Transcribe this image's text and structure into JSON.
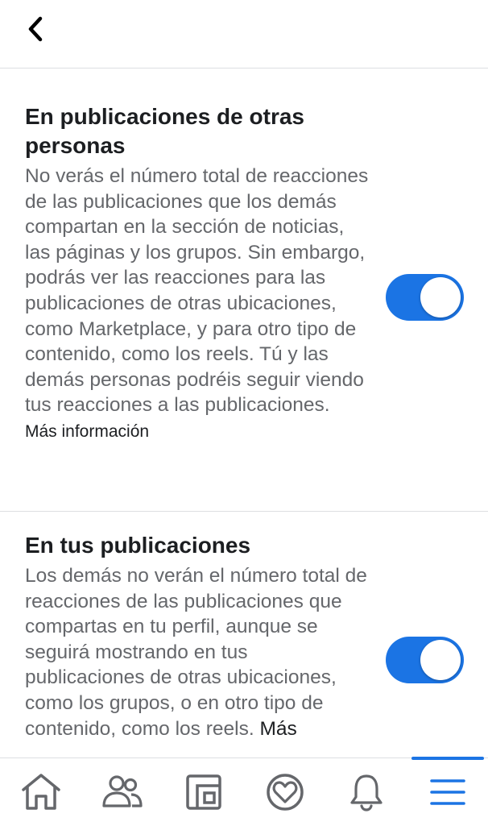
{
  "sections": [
    {
      "title": "En publicaciones de otras personas",
      "description": "No verás el número total de reacciones de las publicaciones que los demás compartan en la sección de noticias, las páginas y los grupos. Sin embargo, podrás ver las reacciones para las publicaciones de otras ubicaciones, como Marketplace, y para otro tipo de contenido, como los reels. Tú y las demás personas podréis seguir viendo tus reacciones a las publicaciones.",
      "more_link": "Más información",
      "toggle_on": true
    },
    {
      "title": "En tus publicaciones",
      "description": "Los demás no verán el número total de reacciones de las publicaciones que compartas en tu perfil, aunque se seguirá mostrando en tus publicaciones de otras ubicaciones, como los grupos, o en otro tipo de contenido, como los reels.",
      "more_link": "Más",
      "toggle_on": true
    }
  ],
  "tabs": [
    {
      "icon": "home-icon",
      "active": false
    },
    {
      "icon": "friends-icon",
      "active": false
    },
    {
      "icon": "feeds-icon",
      "active": false
    },
    {
      "icon": "dating-icon",
      "active": false
    },
    {
      "icon": "bell-icon",
      "active": false
    },
    {
      "icon": "menu-icon",
      "active": true
    }
  ],
  "colors": {
    "accent": "#1b74e4",
    "icon_gray": "#65676b",
    "text_primary": "#1c1e21",
    "text_secondary": "#65676b"
  }
}
